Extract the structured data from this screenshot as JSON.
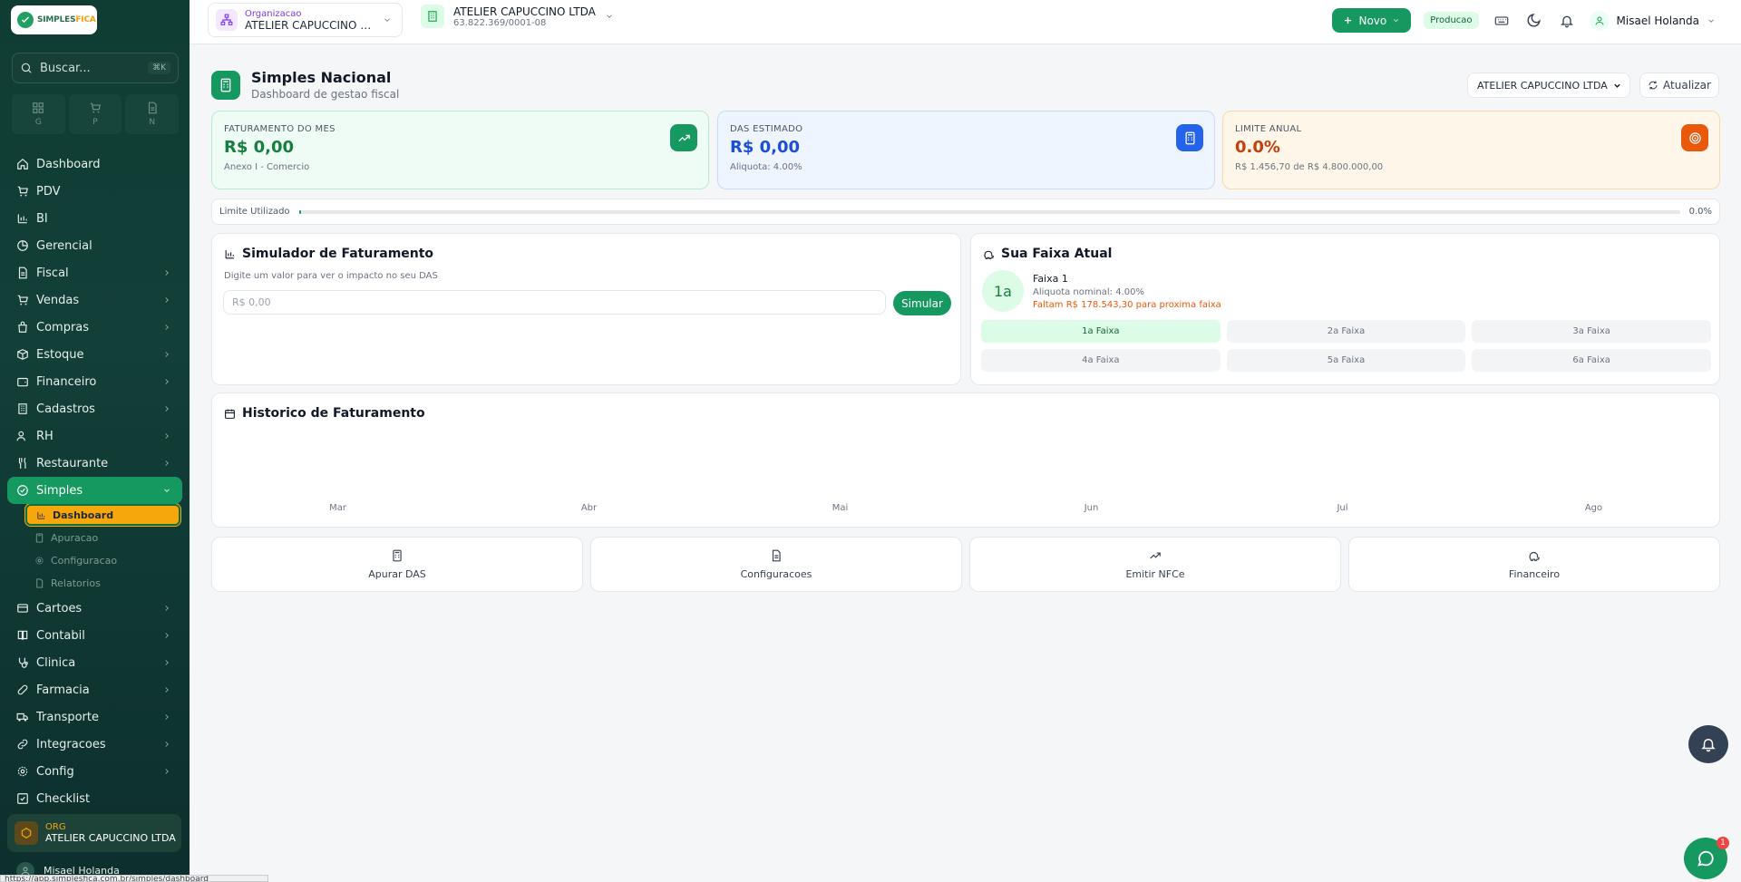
{
  "sidebar": {
    "logo": {
      "brand_main": "SIMPLES",
      "brand_accent": "FICA"
    },
    "search": {
      "placeholder": "Buscar...",
      "shortcut": "⌘K"
    },
    "quick": [
      {
        "label": "G"
      },
      {
        "label": "P"
      },
      {
        "label": "N"
      }
    ],
    "items_top": [
      {
        "label": "Dashboard",
        "icon": "home-icon"
      },
      {
        "label": "PDV",
        "icon": "cart-icon"
      },
      {
        "label": "BI",
        "icon": "bar-chart-icon"
      },
      {
        "label": "Gerencial",
        "icon": "pie-chart-icon"
      },
      {
        "label": "Fiscal",
        "icon": "document-icon"
      },
      {
        "label": "Vendas",
        "icon": "cart-icon"
      },
      {
        "label": "Compras",
        "icon": "bag-icon"
      },
      {
        "label": "Estoque",
        "icon": "box-icon"
      },
      {
        "label": "Financeiro",
        "icon": "wallet-icon"
      },
      {
        "label": "Cadastros",
        "icon": "building-icon"
      },
      {
        "label": "RH",
        "icon": "users-icon"
      },
      {
        "label": "Restaurante",
        "icon": "utensils-icon"
      }
    ],
    "active": {
      "label": "Simples",
      "icon": "percent-icon"
    },
    "sub_items": [
      {
        "label": "Dashboard"
      },
      {
        "label": "Apuracao"
      },
      {
        "label": "Configuracao"
      },
      {
        "label": "Relatorios"
      }
    ],
    "items_bottom": [
      {
        "label": "Cartoes",
        "icon": "card-icon"
      },
      {
        "label": "Contabil",
        "icon": "book-icon"
      },
      {
        "label": "Clinica",
        "icon": "stethoscope-icon"
      },
      {
        "label": "Farmacia",
        "icon": "pill-icon"
      },
      {
        "label": "Transporte",
        "icon": "truck-icon"
      },
      {
        "label": "Integracoes",
        "icon": "link-icon"
      },
      {
        "label": "Config",
        "icon": "gear-icon"
      },
      {
        "label": "Checklist",
        "icon": "check-square-icon"
      }
    ],
    "org": {
      "label": "ORG",
      "name": "ATELIER CAPUCCINO LTDA"
    },
    "user": {
      "name": "Misael Holanda"
    },
    "status_url": "https://app.simplesfica.com.br/simples/dashboard"
  },
  "topbar": {
    "org_select": {
      "label": "Organizacao",
      "value": "ATELIER CAPUCCINO LTDA"
    },
    "company": {
      "name": "ATELIER CAPUCCINO LTDA",
      "cnpj": "63.822.369/0001-08"
    },
    "new_button": "Novo",
    "env_badge": "Producao",
    "user_name": "Misael Holanda"
  },
  "page": {
    "title": "Simples Nacional",
    "subtitle": "Dashboard de gestao fiscal",
    "company_select": "ATELIER CAPUCCINO LTDA",
    "update_button": "Atualizar"
  },
  "kpis": [
    {
      "label": "FATURAMENTO DO MES",
      "value": "R$ 0,00",
      "sub": "Anexo I - Comercio",
      "icon": "trending-up-icon",
      "accent": "#169960"
    },
    {
      "label": "DAS ESTIMADO",
      "value": "R$ 0,00",
      "sub": "Aliquota: 4.00%",
      "icon": "calculator-icon",
      "accent": "#2563eb"
    },
    {
      "label": "LIMITE ANUAL",
      "value": "0.0%",
      "sub": "R$ 1.456,70 de R$ 4.800.000,00",
      "icon": "target-icon",
      "accent": "#ea580c"
    }
  ],
  "limit": {
    "label": "Limite Utilizado",
    "percent_text": "0.0%",
    "percent": 0.0
  },
  "simulator": {
    "title": "Simulador de Faturamento",
    "hint": "Digite um valor para ver o impacto no seu DAS",
    "placeholder": "R$ 0,00",
    "button": "Simular"
  },
  "faixa": {
    "title": "Sua Faixa Atual",
    "badge": "1a",
    "name": "Faixa 1",
    "rate": "Aliquota nominal: 4.00%",
    "remaining": "Faltam R$ 178.543,30 para proxima faixa",
    "options": [
      "1a Faixa",
      "2a Faixa",
      "3a Faixa",
      "4a Faixa",
      "5a Faixa",
      "6a Faixa"
    ],
    "active_index": 0
  },
  "history": {
    "title": "Historico de Faturamento",
    "months": [
      "Mar",
      "Abr",
      "Mai",
      "Jun",
      "Jul",
      "Ago"
    ]
  },
  "actions": [
    {
      "label": "Apurar DAS",
      "icon": "calculator-icon"
    },
    {
      "label": "Configuracoes",
      "icon": "document-icon"
    },
    {
      "label": "Emitir NFCe",
      "icon": "trending-up-icon"
    },
    {
      "label": "Financeiro",
      "icon": "piggy-bank-icon"
    }
  ]
}
